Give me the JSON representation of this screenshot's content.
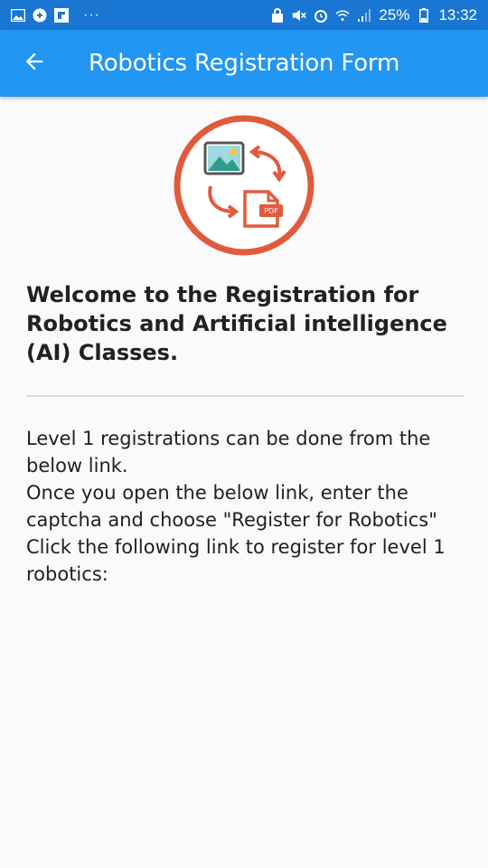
{
  "status_bar": {
    "battery": "25%",
    "time": "13:32",
    "dots": "···",
    "icons": [
      "gallery-icon",
      "app-icon",
      "flipboard-icon",
      "alarm-lock-icon",
      "mute-icon",
      "alarm-icon",
      "wifi-icon",
      "signal-icon",
      "battery-icon"
    ]
  },
  "app_bar": {
    "title": "Robotics Registration Form",
    "back_icon": "arrow-back-icon",
    "color": "#2196f3"
  },
  "logo": {
    "icon": "image-to-pdf-icon",
    "pdf_label": "PDF",
    "accent": "#e05a3c"
  },
  "main": {
    "heading": "Welcome to the Registration for Robotics and Artificial intelligence (AI) Classes.",
    "body": "Level 1 registrations can be done from the below link.\n Once you open the below link, enter the captcha and choose \"Register for Robotics\" Click the following link to register for level 1 robotics:"
  }
}
